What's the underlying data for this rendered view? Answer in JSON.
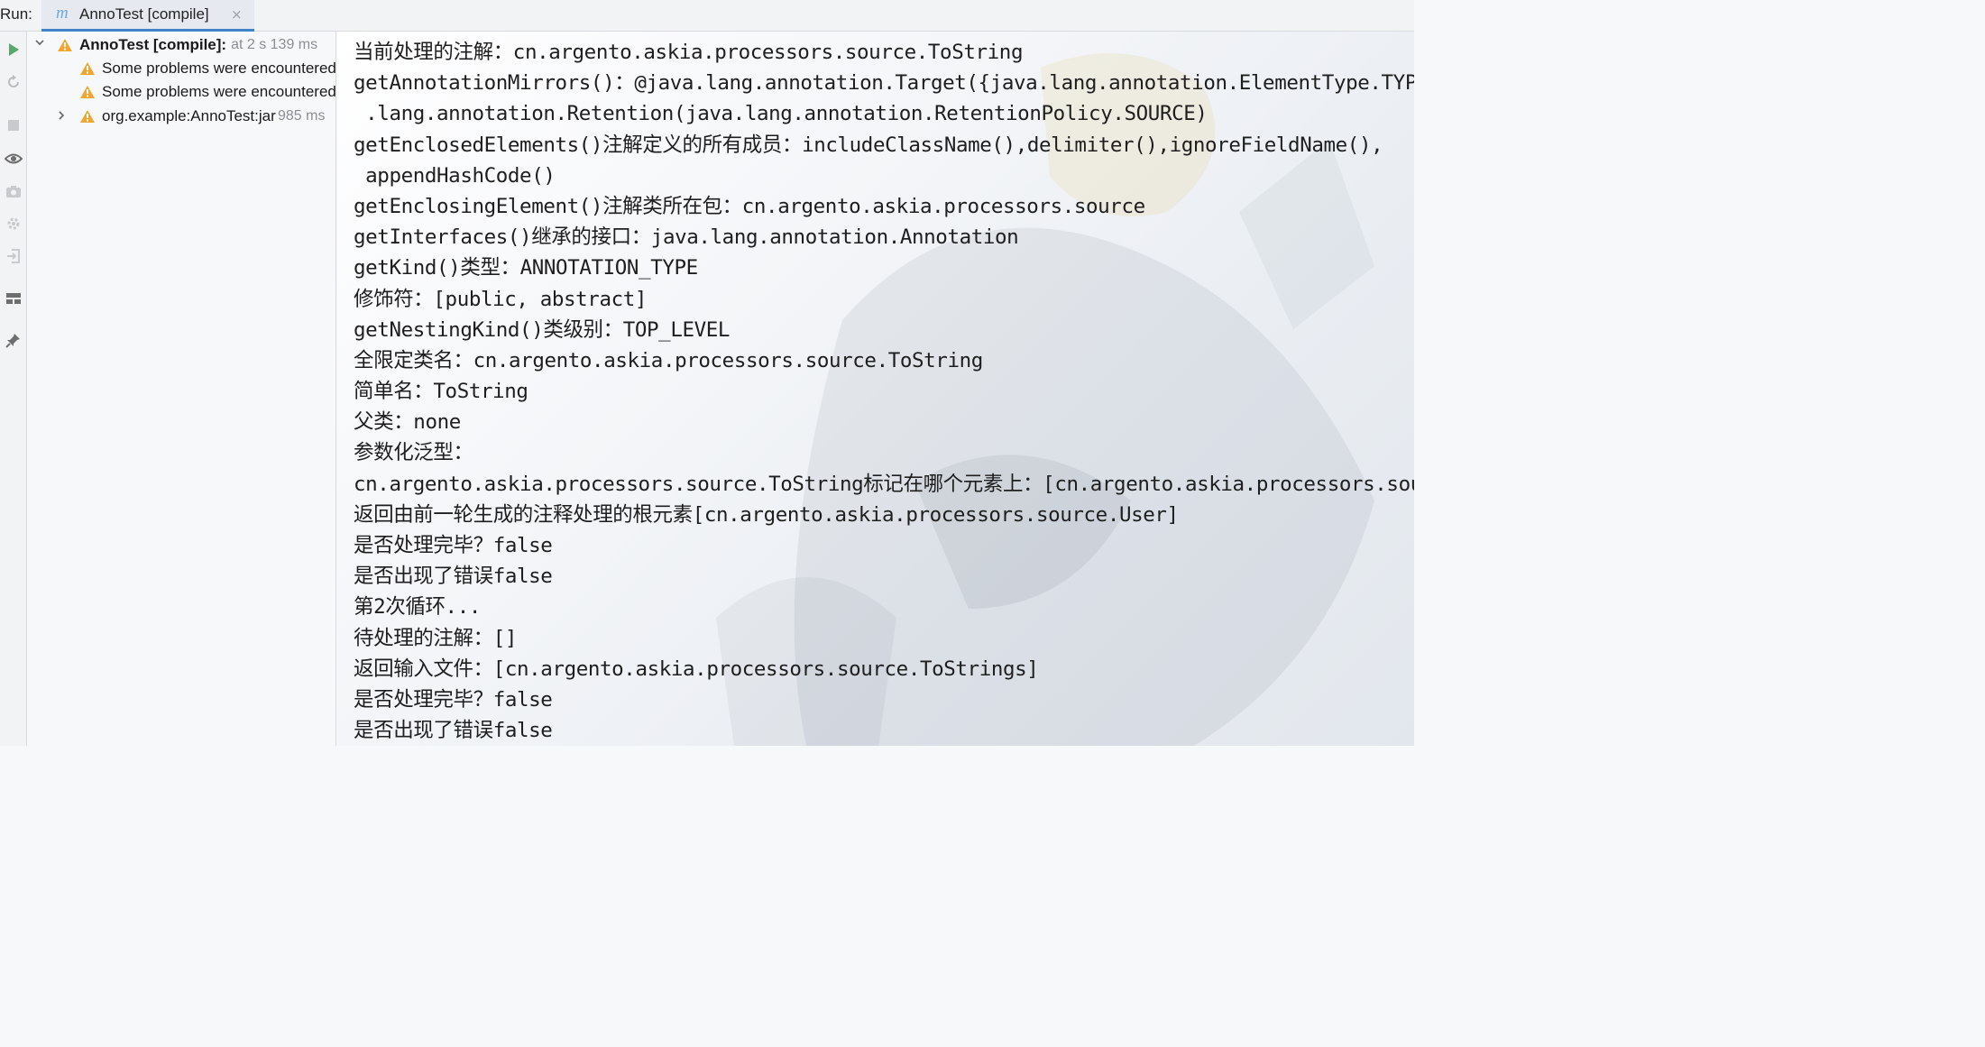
{
  "run_bar": {
    "label": "Run:",
    "tab": {
      "icon": "maven-icon",
      "icon_glyph": "m",
      "title": "AnnoTest [compile]",
      "close_glyph": "×"
    }
  },
  "toolbar": {
    "buttons": [
      {
        "name": "rerun-icon",
        "glyph": "▶",
        "color": "#59a869"
      },
      {
        "name": "rerun-failed-icon",
        "glyph": "↻",
        "color": "#b9bcc1"
      },
      {
        "name": "stop-icon",
        "glyph": "■",
        "color": "#c8cacd"
      },
      {
        "name": "eye-icon",
        "glyph": "◉",
        "color": "#6e6e6e"
      },
      {
        "name": "camera-icon",
        "glyph": "▣",
        "color": "#c8cacd"
      },
      {
        "name": "settings-icon",
        "glyph": "✲",
        "color": "#c8cacd"
      },
      {
        "name": "exit-icon",
        "glyph": "⇥",
        "color": "#c8cacd"
      },
      {
        "name": "layout-icon",
        "glyph": "▤",
        "color": "#6e6e6e"
      },
      {
        "name": "pin-icon",
        "glyph": "✎",
        "color": "#6e6e6e"
      }
    ]
  },
  "tree": {
    "root": {
      "label": "AnnoTest [compile]:",
      "meta": "at 2 s 139 ms"
    },
    "children": [
      {
        "label": "Some problems were encountered while building the effective model"
      },
      {
        "label": "Some problems were encountered while building the effective model"
      },
      {
        "label": "org.example:AnnoTest:jar",
        "meta": "985 ms"
      }
    ],
    "warn_color": "#f0a732"
  },
  "console": {
    "lines": [
      "当前处理的注解：cn.argento.askia.processors.source.ToString",
      "getAnnotationMirrors()：@java.lang.annotation.Target({java.lang.annotation.ElementType.TYPE})",
      " .lang.annotation.Retention(java.lang.annotation.RetentionPolicy.SOURCE)",
      "getEnclosedElements()注解定义的所有成员：includeClassName(),delimiter(),ignoreFieldName(),",
      " appendHashCode()",
      "getEnclosingElement()注解类所在包：cn.argento.askia.processors.source",
      "getInterfaces()继承的接口：java.lang.annotation.Annotation",
      "getKind()类型：ANNOTATION_TYPE",
      "修饰符：[public, abstract]",
      "getNestingKind()类级别：TOP_LEVEL",
      "全限定类名：cn.argento.askia.processors.source.ToString",
      "简单名：ToString",
      "父类：none",
      "参数化泛型：",
      "cn.argento.askia.processors.source.ToString标记在哪个元素上：[cn.argento.askia.processors.source.User]",
      "返回由前一轮生成的注释处理的根元素[cn.argento.askia.processors.source.User]",
      "是否处理完毕？false",
      "是否出现了错误false",
      "第2次循环...",
      "待处理的注解：[]",
      "返回输入文件：[cn.argento.askia.processors.source.ToStrings]",
      "是否处理完毕？false",
      "是否出现了错误false"
    ]
  }
}
